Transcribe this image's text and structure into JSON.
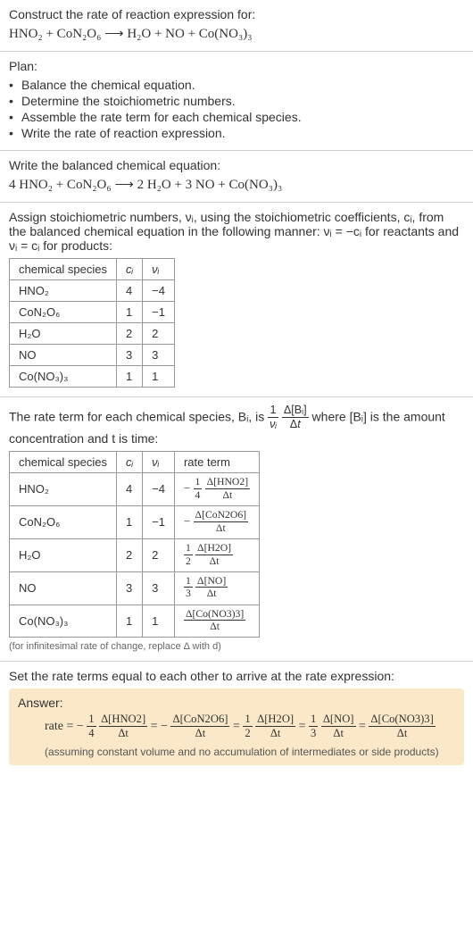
{
  "prompt": {
    "line1": "Construct the rate of reaction expression for:",
    "unbalanced_eq": "HNO₂ + CoN₂O₆ ⟶ H₂O + NO + Co(NO₃)₃"
  },
  "plan": {
    "title": "Plan:",
    "items": [
      "Balance the chemical equation.",
      "Determine the stoichiometric numbers.",
      "Assemble the rate term for each chemical species.",
      "Write the rate of reaction expression."
    ]
  },
  "balanced": {
    "title": "Write the balanced chemical equation:",
    "eq": "4 HNO₂ + CoN₂O₆ ⟶ 2 H₂O + 3 NO + Co(NO₃)₃"
  },
  "stoich": {
    "intro_a": "Assign stoichiometric numbers, νᵢ, using the stoichiometric coefficients, cᵢ, from the balanced chemical equation in the following manner: νᵢ = −cᵢ for reactants and νᵢ = cᵢ for products:",
    "headers": {
      "species": "chemical species",
      "ci": "cᵢ",
      "nui": "νᵢ"
    },
    "rows": [
      {
        "species": "HNO₂",
        "ci": "4",
        "nui": "−4"
      },
      {
        "species": "CoN₂O₆",
        "ci": "1",
        "nui": "−1"
      },
      {
        "species": "H₂O",
        "ci": "2",
        "nui": "2"
      },
      {
        "species": "NO",
        "ci": "3",
        "nui": "3"
      },
      {
        "species": "Co(NO₃)₃",
        "ci": "1",
        "nui": "1"
      }
    ]
  },
  "rateterm": {
    "intro_pre": "The rate term for each chemical species, Bᵢ, is ",
    "intro_post": " where [Bᵢ] is the amount concentration and t is time:",
    "headers": {
      "species": "chemical species",
      "ci": "cᵢ",
      "nui": "νᵢ",
      "rate": "rate term"
    },
    "rows": [
      {
        "species": "HNO₂",
        "ci": "4",
        "nui": "−4",
        "coef_top": "1",
        "coef_bot": "4",
        "neg": "−",
        "dtop": "Δ[HNO2]",
        "dbot": "Δt"
      },
      {
        "species": "CoN₂O₆",
        "ci": "1",
        "nui": "−1",
        "coef_top": "",
        "coef_bot": "",
        "neg": "−",
        "dtop": "Δ[CoN2O6]",
        "dbot": "Δt"
      },
      {
        "species": "H₂O",
        "ci": "2",
        "nui": "2",
        "coef_top": "1",
        "coef_bot": "2",
        "neg": "",
        "dtop": "Δ[H2O]",
        "dbot": "Δt"
      },
      {
        "species": "NO",
        "ci": "3",
        "nui": "3",
        "coef_top": "1",
        "coef_bot": "3",
        "neg": "",
        "dtop": "Δ[NO]",
        "dbot": "Δt"
      },
      {
        "species": "Co(NO₃)₃",
        "ci": "1",
        "nui": "1",
        "coef_top": "",
        "coef_bot": "",
        "neg": "",
        "dtop": "Δ[Co(NO3)3]",
        "dbot": "Δt"
      }
    ],
    "foot": "(for infinitesimal rate of change, replace Δ with d)"
  },
  "final": {
    "title": "Set the rate terms equal to each other to arrive at the rate expression:",
    "answer_label": "Answer:",
    "rate_word": "rate = ",
    "note": "(assuming constant volume and no accumulation of intermediates or side products)"
  },
  "chart_data": {
    "type": "table",
    "tables": [
      {
        "title": "stoichiometric numbers",
        "columns": [
          "chemical species",
          "c_i",
          "nu_i"
        ],
        "rows": [
          [
            "HNO2",
            4,
            -4
          ],
          [
            "CoN2O6",
            1,
            -1
          ],
          [
            "H2O",
            2,
            2
          ],
          [
            "NO",
            3,
            3
          ],
          [
            "Co(NO3)3",
            1,
            1
          ]
        ]
      },
      {
        "title": "rate terms",
        "columns": [
          "chemical species",
          "c_i",
          "nu_i",
          "rate term"
        ],
        "rows": [
          [
            "HNO2",
            4,
            -4,
            "-(1/4) Δ[HNO2]/Δt"
          ],
          [
            "CoN2O6",
            1,
            -1,
            "- Δ[CoN2O6]/Δt"
          ],
          [
            "H2O",
            2,
            2,
            "(1/2) Δ[H2O]/Δt"
          ],
          [
            "NO",
            3,
            3,
            "(1/3) Δ[NO]/Δt"
          ],
          [
            "Co(NO3)3",
            1,
            1,
            "Δ[Co(NO3)3]/Δt"
          ]
        ]
      }
    ],
    "rate_expression": "rate = -(1/4) Δ[HNO2]/Δt = - Δ[CoN2O6]/Δt = (1/2) Δ[H2O]/Δt = (1/3) Δ[NO]/Δt = Δ[Co(NO3)3]/Δt"
  }
}
